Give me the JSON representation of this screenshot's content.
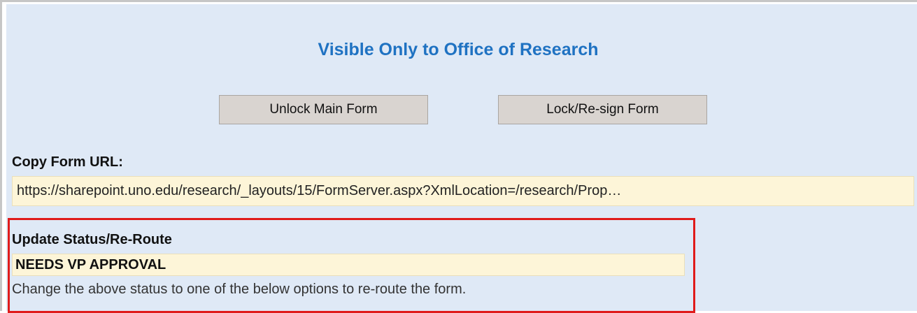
{
  "section": {
    "title": "Visible Only to Office of Research"
  },
  "buttons": {
    "unlock_label": "Unlock Main Form",
    "lock_label": "Lock/Re-sign Form"
  },
  "copy_url": {
    "label": "Copy Form URL:",
    "value": "https://sharepoint.uno.edu/research/_layouts/15/FormServer.aspx?XmlLocation=/research/Prop…"
  },
  "status": {
    "label": "Update Status/Re-Route",
    "value": "NEEDS VP APPROVAL",
    "help_text": "Change the above status to one of the below options to re-route the form."
  },
  "colors": {
    "panel_background": "#dfe9f6",
    "title": "#1f72c2",
    "field_background": "#fdf5d8",
    "highlight_border": "#e01b1b"
  }
}
